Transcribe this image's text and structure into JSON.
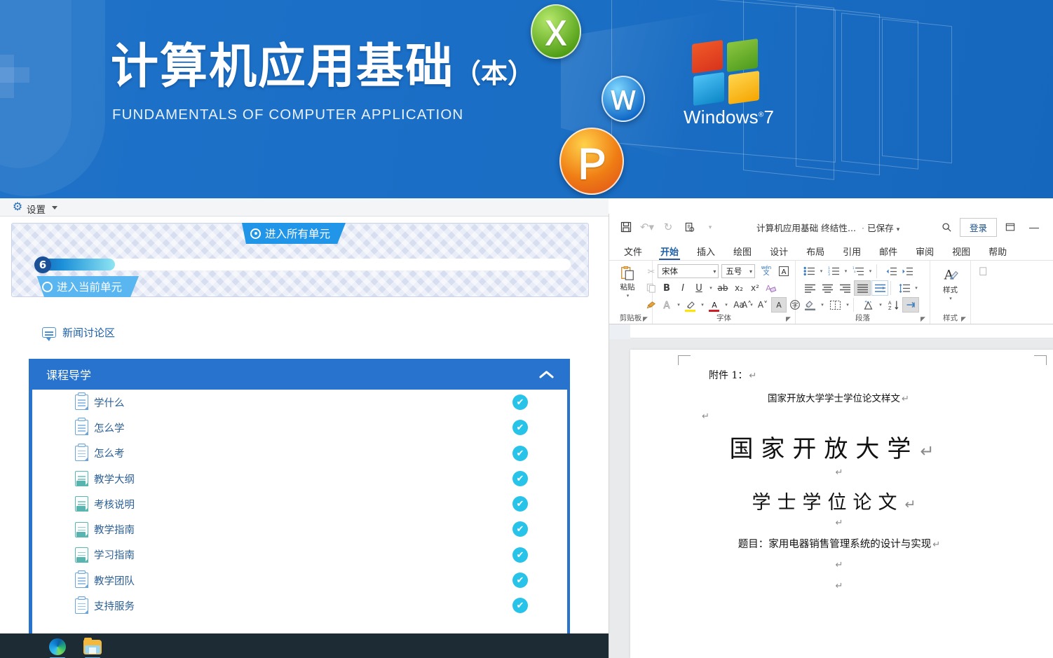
{
  "banner": {
    "title_cn": "计算机应用基础",
    "title_paren": "（本）",
    "title_en": "FUNDAMENTALS OF COMPUTER APPLICATION",
    "os_label": "Windows",
    "os_version": "7",
    "os_reg": "®",
    "icons": [
      {
        "name": "excel-oval-icon",
        "glyph": "Ｘ",
        "color": "#4e9c14"
      },
      {
        "name": "word-oval-icon",
        "glyph": "Ｗ",
        "color": "#0a63c4"
      },
      {
        "name": "powerpoint-oval-icon",
        "glyph": "Ｐ",
        "color": "#ef7c14"
      }
    ],
    "accent_color": "#1a6ec4"
  },
  "settings_bar": {
    "gear_icon": "gear-icon",
    "label": "设置",
    "caret": "caret-down-icon"
  },
  "lms": {
    "tab_all_units": "进入所有单元",
    "tab_current_unit": "进入当前单元",
    "progress": {
      "badge": "6",
      "percent": 15
    },
    "news": {
      "icon": "chat-bubble-icon",
      "label": "新闻讨论区"
    },
    "guide": {
      "header": "课程导学",
      "collapse_icon": "chevron-up-icon",
      "header_color": "#2773cd",
      "check_color": "#27c3e8",
      "items": [
        {
          "label": "学什么",
          "icon": "note-doc-icon",
          "icon_style": "blue",
          "status": "✔"
        },
        {
          "label": "怎么学",
          "icon": "note-doc-icon",
          "icon_style": "blue",
          "status": "✔"
        },
        {
          "label": "怎么考",
          "icon": "note-doc-icon",
          "icon_style": "blue",
          "status": "✔"
        },
        {
          "label": "教学大纲",
          "icon": "text-doc-icon",
          "icon_style": "teal",
          "status": "✔"
        },
        {
          "label": "考核说明",
          "icon": "text-doc-icon",
          "icon_style": "teal",
          "status": "✔"
        },
        {
          "label": "教学指南",
          "icon": "text-doc-icon",
          "icon_style": "teal",
          "status": "✔"
        },
        {
          "label": "学习指南",
          "icon": "text-doc-icon",
          "icon_style": "teal",
          "status": "✔"
        },
        {
          "label": "教学团队",
          "icon": "note-doc-icon",
          "icon_style": "blue",
          "status": "✔"
        },
        {
          "label": "支持服务",
          "icon": "note-doc-icon",
          "icon_style": "blue",
          "status": "✔"
        }
      ]
    }
  },
  "word": {
    "titlebar": {
      "doc_name": "计算机应用基础 终结性...",
      "separator": "·",
      "saved_status": "已保存",
      "saved_caret": "▾",
      "search_icon": "search-icon",
      "signin_label": "登录",
      "restore_icon": "restore-window-icon",
      "minimize_icon": "minimize-window-icon",
      "qat": [
        {
          "name": "save-icon",
          "glyph": "▣"
        },
        {
          "name": "undo-icon",
          "glyph": "↶"
        },
        {
          "name": "redo-icon",
          "glyph": "↻"
        },
        {
          "name": "print-preview-icon",
          "glyph": "⎙"
        },
        {
          "name": "customize-qat-icon",
          "glyph": "▾"
        }
      ]
    },
    "tabs": [
      {
        "label": "文件",
        "active": false
      },
      {
        "label": "开始",
        "active": true
      },
      {
        "label": "插入",
        "active": false
      },
      {
        "label": "绘图",
        "active": false
      },
      {
        "label": "设计",
        "active": false
      },
      {
        "label": "布局",
        "active": false
      },
      {
        "label": "引用",
        "active": false
      },
      {
        "label": "邮件",
        "active": false
      },
      {
        "label": "审阅",
        "active": false
      },
      {
        "label": "视图",
        "active": false
      },
      {
        "label": "帮助",
        "active": false
      }
    ],
    "ribbon": {
      "clipboard": {
        "group_label": "剪贴板",
        "paste_label": "粘贴",
        "paste_icon": "paste-icon",
        "cut_icon": "scissors-icon",
        "copy_icon": "copy-icon",
        "format_painter_icon": "format-painter-icon"
      },
      "font": {
        "group_label": "字体",
        "font_name": "宋体",
        "font_size": "五号",
        "bold": "B",
        "italic": "I",
        "underline": "U",
        "strikethrough": "ab",
        "subscript": "x₂",
        "superscript": "x²",
        "clear_format_icon": "clear-formatting-icon",
        "text_effects_icon": "text-effects-icon",
        "highlight_icon": "text-highlight-icon",
        "font_color_icon": "font-color-icon",
        "change_case": "Aa",
        "grow_font": "A˄",
        "shrink_font": "A˅",
        "char_shading_icon": "character-shading-icon",
        "enclose_char_icon": "enclose-character-icon",
        "phonetic_guide_top": "wén",
        "phonetic_guide_bottom": "文",
        "char_border_icon": "character-border-icon"
      },
      "paragraph": {
        "group_label": "段落",
        "bullets_icon": "bullet-list-icon",
        "numbering_icon": "numbered-list-icon",
        "multilevel_icon": "multilevel-list-icon",
        "decrease_indent_icon": "decrease-indent-icon",
        "increase_indent_icon": "increase-indent-icon",
        "align_left_icon": "align-left-icon",
        "align_center_icon": "align-center-icon",
        "align_right_icon": "align-right-icon",
        "justify_icon": "justify-icon",
        "distribute_icon": "distributed-align-icon",
        "line_spacing_icon": "line-spacing-icon",
        "shading_icon": "paragraph-shading-icon",
        "borders_icon": "borders-icon",
        "asian_layout_icon": "asian-layout-icon",
        "sort_icon": "sort-az-icon",
        "show_marks_icon": "show-formatting-marks-icon"
      },
      "styles": {
        "group_label": "样式",
        "styles_label": "样式",
        "styles_icon": "styles-pane-icon"
      }
    },
    "document": {
      "attachment": "附件 1：",
      "subtitle": "国家开放大学学士学位论文样文",
      "heading1": "国家开放大学",
      "heading2": "学士学位论文",
      "topic": "题目：家用电器销售管理系统的设计与实现",
      "pilcrow": "↵"
    }
  },
  "taskbar": {
    "items": [
      {
        "name": "taskbar-edge",
        "icon": "microsoft-edge-icon"
      },
      {
        "name": "taskbar-file-explorer",
        "icon": "file-explorer-icon"
      }
    ],
    "background": "#1d2b35"
  }
}
